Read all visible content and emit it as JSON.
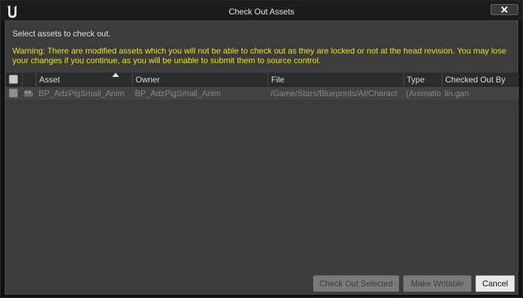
{
  "window": {
    "title": "Check Out Assets"
  },
  "dialog": {
    "instructions": "Select assets to check out.",
    "warning": "Warning: There are modified assets which you will not be able to check out as they are locked or not at the head revision. You may lose your changes if you continue, as you will be unable to submit them to source control."
  },
  "table": {
    "columns": {
      "asset": "Asset",
      "owner": "Owner",
      "file": "File",
      "type": "Type",
      "checked_out_by": "Checked Out By"
    },
    "sort": {
      "column": "asset",
      "direction": "ascending"
    },
    "rows": [
      {
        "checked": false,
        "icon": "animation-blueprint-icon",
        "asset": "BP_AdzPigSmall_Anim",
        "owner": "BP_AdzPigSmall_Anim",
        "file": "/Game/Stars/Blueprints/AI/Charact",
        "type": "(Animatio",
        "checked_out_by": "lin.gan"
      }
    ]
  },
  "buttons": {
    "check_out_selected": "Check Out Selected",
    "make_writable": "Make Writable",
    "cancel": "Cancel"
  },
  "colors": {
    "warning_text": "#f0e30a",
    "panel_bg": "#3c3c3c",
    "title_bar": "#1c1c1c"
  }
}
